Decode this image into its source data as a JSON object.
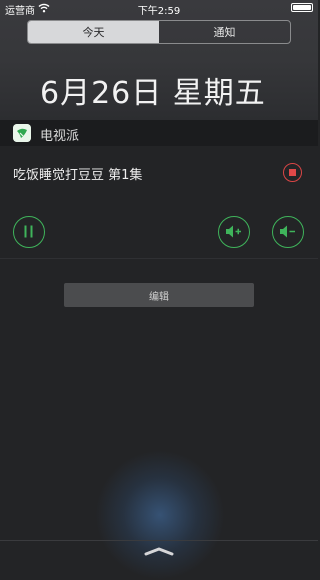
{
  "status_bar": {
    "carrier": "运营商",
    "time": "下午2:59",
    "wifi_icon": "wifi-icon",
    "battery_icon": "battery-icon"
  },
  "tabs": [
    {
      "label": "今天",
      "active": true
    },
    {
      "label": "通知",
      "active": false
    }
  ],
  "date": "6月26日 星期五",
  "widget": {
    "app_name": "电视派",
    "app_icon": "tv-app-icon",
    "episode_title": "吃饭睡觉打豆豆 第1集",
    "controls": {
      "pause_icon": "pause-icon",
      "volume_up_icon": "volume-up-icon",
      "volume_down_icon": "volume-down-icon",
      "stop_icon": "stop-icon"
    }
  },
  "edit_button": {
    "label": "编辑"
  },
  "colors": {
    "accent_green": "#3fb45b",
    "stop_red": "#e04848"
  }
}
